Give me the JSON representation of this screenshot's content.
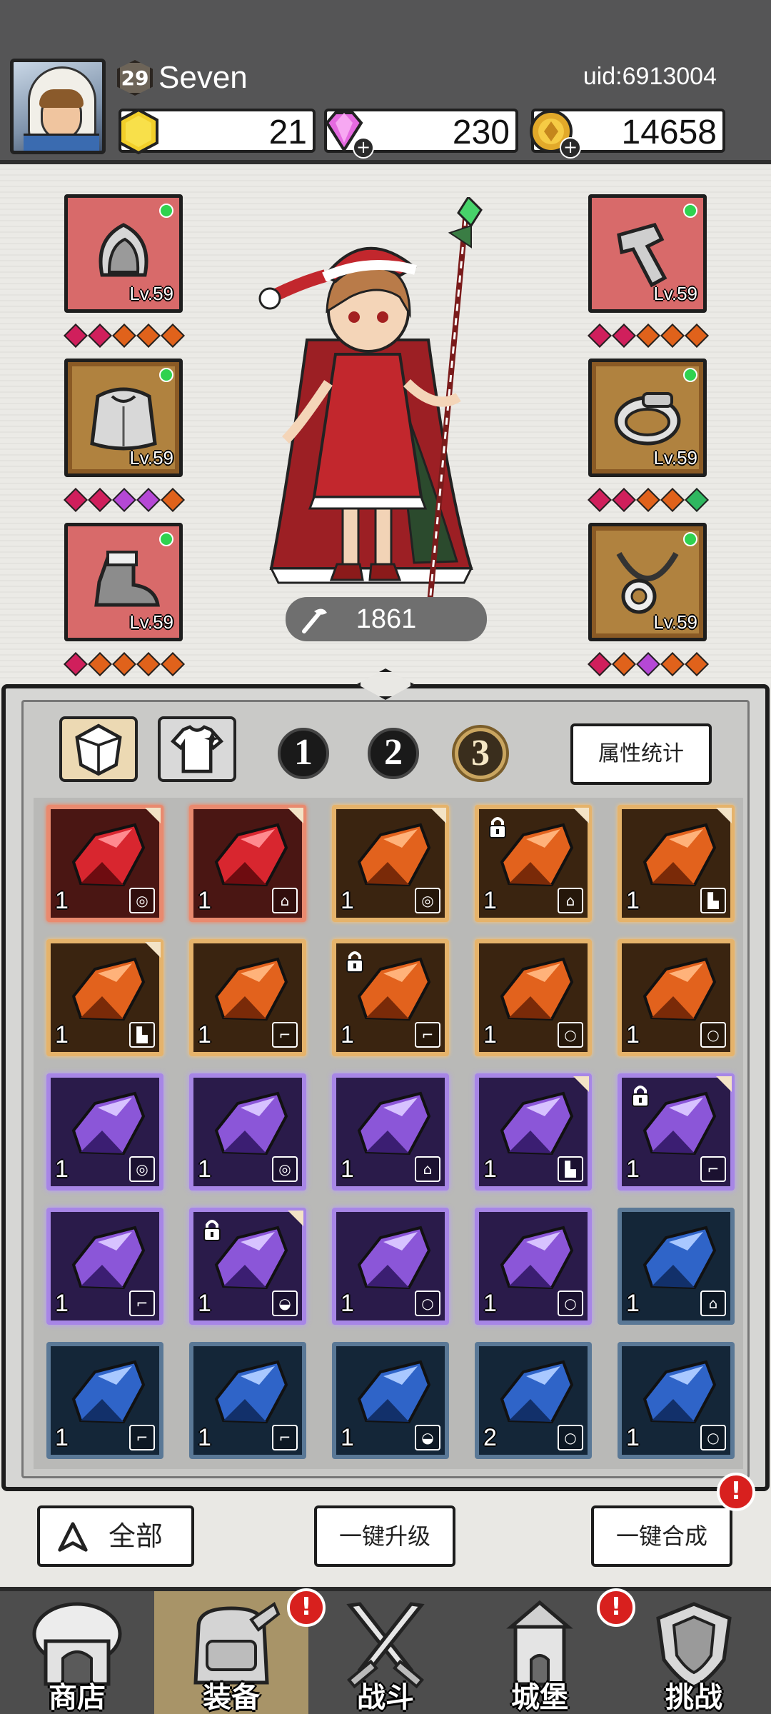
{
  "player": {
    "level": "29",
    "name": "Seven",
    "uid": "uid:6913004"
  },
  "currencies": [
    {
      "icon": "gold-hexagon-icon",
      "value": "21"
    },
    {
      "icon": "diamond-gem-icon",
      "value": "230"
    },
    {
      "icon": "gold-coin-icon",
      "value": "14658"
    }
  ],
  "equipment": {
    "left": [
      {
        "icon": "hood-icon",
        "level": "Lv.59",
        "color": "#d86a6a"
      },
      {
        "icon": "cape-armor-icon",
        "level": "Lv.59",
        "color": "#b0823f"
      },
      {
        "icon": "boot-icon",
        "level": "Lv.59",
        "color": "#d86a6a"
      }
    ],
    "right": [
      {
        "icon": "bracer-icon",
        "level": "Lv.59",
        "color": "#d86a6a"
      },
      {
        "icon": "ring-icon",
        "level": "Lv.59",
        "color": "#b0823f"
      },
      {
        "icon": "amulet-icon",
        "level": "Lv.59",
        "color": "#b0823f"
      }
    ],
    "gem_rows": {
      "left": [
        [
          "#d01f5c",
          "#d01f5c",
          "#e0621b",
          "#e0621b",
          "#e0621b"
        ],
        [
          "#d01f5c",
          "#d01f5c",
          "#b548d6",
          "#b548d6",
          "#e0621b"
        ],
        [
          "#d01f5c",
          "#e0621b",
          "#e0621b",
          "#e0621b",
          "#e0621b"
        ]
      ],
      "right": [
        [
          "#d01f5c",
          "#d01f5c",
          "#e0621b",
          "#e0621b",
          "#e0621b"
        ],
        [
          "#d01f5c",
          "#d01f5c",
          "#e0621b",
          "#e0621b",
          "#2fb860"
        ],
        [
          "#d01f5c",
          "#e0621b",
          "#b548d6",
          "#e0621b",
          "#e0621b"
        ]
      ]
    }
  },
  "power": "1861",
  "inventory": {
    "category_tabs": [
      "gem-icon",
      "shirt-icon"
    ],
    "number_tabs": [
      "1",
      "2",
      "3"
    ],
    "selected_number_tab": "3",
    "stats_button": "属性统计",
    "items": [
      {
        "rarity": "red",
        "qty": "1",
        "slot": "ring",
        "corner": true,
        "locked": false
      },
      {
        "rarity": "red",
        "qty": "1",
        "slot": "cape",
        "corner": true,
        "locked": false
      },
      {
        "rarity": "orange",
        "qty": "1",
        "slot": "ring",
        "corner": true,
        "locked": false
      },
      {
        "rarity": "orange",
        "qty": "1",
        "slot": "cape",
        "corner": true,
        "locked": true
      },
      {
        "rarity": "orange",
        "qty": "1",
        "slot": "boot",
        "corner": true,
        "locked": false
      },
      {
        "rarity": "orange",
        "qty": "1",
        "slot": "boot",
        "corner": true,
        "locked": false
      },
      {
        "rarity": "orange",
        "qty": "1",
        "slot": "bracer",
        "corner": false,
        "locked": false
      },
      {
        "rarity": "orange",
        "qty": "1",
        "slot": "bracer",
        "corner": false,
        "locked": true
      },
      {
        "rarity": "orange",
        "qty": "1",
        "slot": "amulet",
        "corner": false,
        "locked": false
      },
      {
        "rarity": "orange",
        "qty": "1",
        "slot": "amulet",
        "corner": false,
        "locked": false
      },
      {
        "rarity": "purple",
        "qty": "1",
        "slot": "ring",
        "corner": false,
        "locked": false
      },
      {
        "rarity": "purple",
        "qty": "1",
        "slot": "ring",
        "corner": false,
        "locked": false
      },
      {
        "rarity": "purple",
        "qty": "1",
        "slot": "cape",
        "corner": false,
        "locked": false
      },
      {
        "rarity": "purple",
        "qty": "1",
        "slot": "boot",
        "corner": true,
        "locked": false
      },
      {
        "rarity": "purple",
        "qty": "1",
        "slot": "bracer",
        "corner": true,
        "locked": true
      },
      {
        "rarity": "purple",
        "qty": "1",
        "slot": "bracer",
        "corner": false,
        "locked": false
      },
      {
        "rarity": "purple",
        "qty": "1",
        "slot": "hood",
        "corner": true,
        "locked": true
      },
      {
        "rarity": "purple",
        "qty": "1",
        "slot": "amulet",
        "corner": false,
        "locked": false
      },
      {
        "rarity": "purple",
        "qty": "1",
        "slot": "amulet",
        "corner": false,
        "locked": false
      },
      {
        "rarity": "blue",
        "qty": "1",
        "slot": "cape",
        "corner": false,
        "locked": false
      },
      {
        "rarity": "blue",
        "qty": "1",
        "slot": "bracer",
        "corner": false,
        "locked": false
      },
      {
        "rarity": "blue",
        "qty": "1",
        "slot": "bracer",
        "corner": false,
        "locked": false
      },
      {
        "rarity": "blue",
        "qty": "1",
        "slot": "hood",
        "corner": false,
        "locked": false
      },
      {
        "rarity": "blue",
        "qty": "2",
        "slot": "amulet",
        "corner": false,
        "locked": false
      },
      {
        "rarity": "blue",
        "qty": "1",
        "slot": "amulet",
        "corner": false,
        "locked": false
      }
    ]
  },
  "actions": {
    "filter_all": "全部",
    "one_click_upgrade": "一键升级",
    "one_click_merge": "一键合成",
    "alert_mark": "!"
  },
  "nav": [
    {
      "label": "商店",
      "icon": "shop-hut-icon",
      "active": false,
      "alert": false
    },
    {
      "label": "装备",
      "icon": "backpack-icon",
      "active": true,
      "alert": true
    },
    {
      "label": "战斗",
      "icon": "crossed-swords-icon",
      "active": false,
      "alert": false
    },
    {
      "label": "城堡",
      "icon": "castle-icon",
      "active": false,
      "alert": true
    },
    {
      "label": "挑战",
      "icon": "shield-crest-icon",
      "active": false,
      "alert": false
    }
  ],
  "colors": {
    "header_bg": "#555556",
    "red_rarity": "#e98a6f",
    "orange_rarity": "#e5b36b",
    "purple_rarity": "#a786e6",
    "blue_rarity": "#5a7896",
    "alert": "#d8201e"
  }
}
